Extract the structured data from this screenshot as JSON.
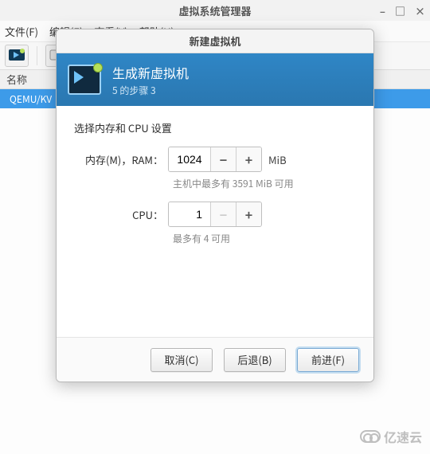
{
  "main": {
    "title": "虚拟系统管理器",
    "menu": {
      "file": "文件(F)",
      "edit": "编辑(E)",
      "view": "查看(V)",
      "help": "帮助(H)"
    },
    "list_header": "名称",
    "connection": "QEMU/KV"
  },
  "dialog": {
    "title": "新建虚拟机",
    "header_title": "生成新虚拟机",
    "header_sub": "5 的步骤 3",
    "section": "选择内存和 CPU 设置",
    "mem": {
      "label": "内存(M)，RAM：",
      "value": "1024",
      "unit": "MiB",
      "hint": "主机中最多有 3591 MiB 可用"
    },
    "cpu": {
      "label": "CPU：",
      "value": "1",
      "hint": "最多有 4 可用"
    },
    "buttons": {
      "cancel": "取消(C)",
      "back": "后退(B)",
      "forward": "前进(F)"
    }
  },
  "watermark": "亿速云"
}
